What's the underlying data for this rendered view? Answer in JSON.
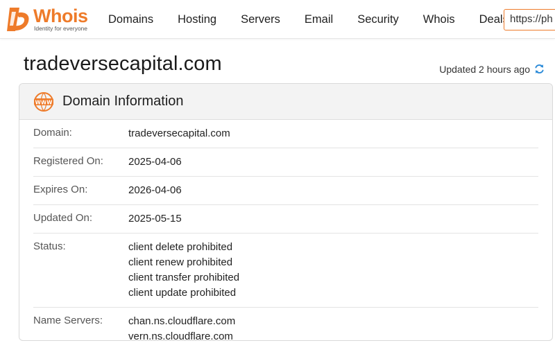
{
  "brand": {
    "name": "Whois",
    "tagline": "Identity for everyone",
    "accent": "#ee7b2a"
  },
  "nav": {
    "items": [
      "Domains",
      "Hosting",
      "Servers",
      "Email",
      "Security",
      "Whois",
      "Deals"
    ]
  },
  "search": {
    "value": "https://ph"
  },
  "page": {
    "domain_title": "tradeversecapital.com",
    "updated_text": "Updated 2 hours ago",
    "refresh_icon": "refresh-icon"
  },
  "card": {
    "title": "Domain Information",
    "icon": "www-icon",
    "rows": [
      {
        "label": "Domain:",
        "values": [
          "tradeversecapital.com"
        ]
      },
      {
        "label": "Registered On:",
        "values": [
          "2025-04-06"
        ]
      },
      {
        "label": "Expires On:",
        "values": [
          "2026-04-06"
        ]
      },
      {
        "label": "Updated On:",
        "values": [
          "2025-05-15"
        ]
      },
      {
        "label": "Status:",
        "values": [
          "client delete prohibited",
          "client renew prohibited",
          "client transfer prohibited",
          "client update prohibited"
        ]
      },
      {
        "label": "Name Servers:",
        "values": [
          "chan.ns.cloudflare.com",
          "vern.ns.cloudflare.com"
        ]
      }
    ]
  }
}
